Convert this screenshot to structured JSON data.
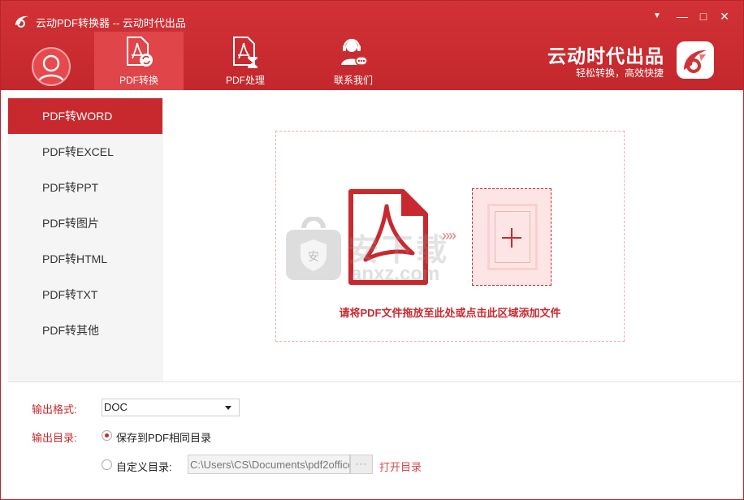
{
  "window": {
    "title": "云动PDF转换器 -- 云动时代出品",
    "controls": {
      "dropdown": "▼",
      "minimize": "—",
      "maximize": "□",
      "close": "✕"
    }
  },
  "nav": {
    "tabs": [
      {
        "label": "PDF转换",
        "icon": "pdf-convert-icon",
        "active": true
      },
      {
        "label": "PDF处理",
        "icon": "pdf-process-icon",
        "active": false
      },
      {
        "label": "联系我们",
        "icon": "customer-service-icon",
        "active": false
      }
    ]
  },
  "brand": {
    "name": "云动时代出品",
    "slogan": "轻松转换，高效快捷"
  },
  "sidebar": {
    "items": [
      {
        "label": "PDF转WORD",
        "active": true
      },
      {
        "label": "PDF转EXCEL",
        "active": false
      },
      {
        "label": "PDF转PPT",
        "active": false
      },
      {
        "label": "PDF转图片",
        "active": false
      },
      {
        "label": "PDF转HTML",
        "active": false
      },
      {
        "label": "PDF转TXT",
        "active": false
      },
      {
        "label": "PDF转其他",
        "active": false
      }
    ]
  },
  "dropzone": {
    "hint": "请将PDF文件拖放至此处或点击此区域添加文件",
    "chevrons": "»»"
  },
  "watermark": {
    "text": "安下载",
    "url": "anxz.com",
    "shield_char": "安"
  },
  "output": {
    "format_label": "输出格式:",
    "format_value": "DOC",
    "dir_label": "输出目录:",
    "option_same": "保存到PDF相同目录",
    "option_custom": "自定义目录:",
    "custom_path": "C:\\Users\\CS\\Documents\\pdf2office",
    "browse_label": "···",
    "open_dir": "打开目录"
  },
  "colors": {
    "accent": "#c8292e",
    "header": "#d23236"
  }
}
